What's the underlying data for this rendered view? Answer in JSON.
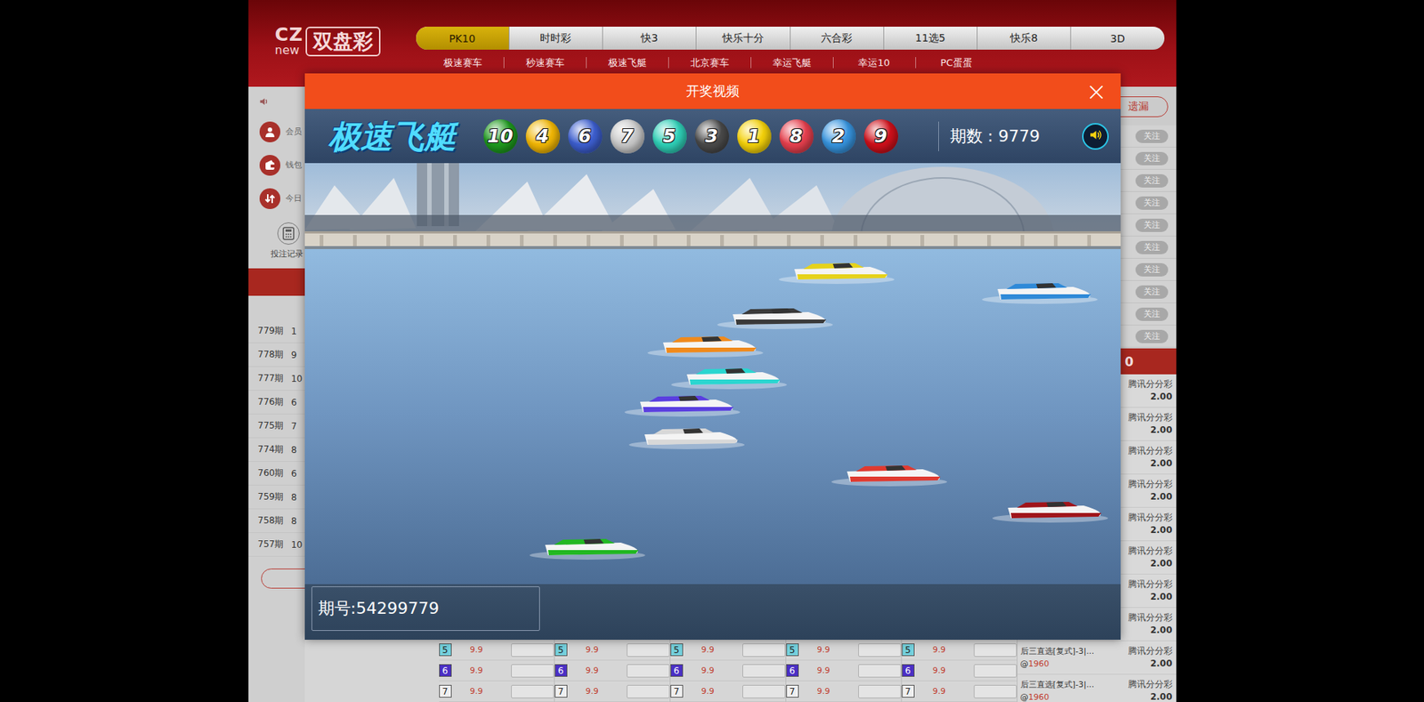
{
  "logo": {
    "cz": "CZ",
    "new": "new",
    "name": "双盘彩"
  },
  "nav": [
    {
      "label": "PK10",
      "selected": true
    },
    {
      "label": "时时彩",
      "selected": false
    },
    {
      "label": "快3",
      "selected": false
    },
    {
      "label": "快乐十分",
      "selected": false
    },
    {
      "label": "六合彩",
      "selected": false
    },
    {
      "label": "11选5",
      "selected": false
    },
    {
      "label": "快乐8",
      "selected": false
    },
    {
      "label": "3D",
      "selected": false
    }
  ],
  "subnav": [
    {
      "label": "极速赛车"
    },
    {
      "label": "秒速赛车"
    },
    {
      "label": "极速飞艇"
    },
    {
      "label": "北京赛车"
    },
    {
      "label": "幸运飞艇"
    },
    {
      "label": "幸运10"
    },
    {
      "label": "PC蛋蛋"
    }
  ],
  "sidebar": {
    "items": [
      {
        "label": "会员"
      },
      {
        "label": "钱包"
      },
      {
        "label": "今日"
      }
    ],
    "record": "投注记录",
    "history": [
      {
        "issue": "779期",
        "num": "1"
      },
      {
        "issue": "778期",
        "num": "9"
      },
      {
        "issue": "777期",
        "num": "10"
      },
      {
        "issue": "776期",
        "num": "6"
      },
      {
        "issue": "775期",
        "num": "7"
      },
      {
        "issue": "774期",
        "num": "8"
      },
      {
        "issue": "760期",
        "num": "6"
      },
      {
        "issue": "759期",
        "num": "8"
      },
      {
        "issue": "758期",
        "num": "8"
      },
      {
        "issue": "757期",
        "num": "10"
      }
    ]
  },
  "right_panel": {
    "button": "遗漏",
    "follow": [
      {
        "label": "关注"
      },
      {
        "label": "关注"
      },
      {
        "label": "关注"
      },
      {
        "label": "关注"
      },
      {
        "label": "关注"
      },
      {
        "label": "关注"
      },
      {
        "label": "关注"
      },
      {
        "label": "关注"
      },
      {
        "label": "关注"
      },
      {
        "label": "关注"
      }
    ],
    "bar": "0",
    "rows": [
      {
        "lottery": "腾讯分分彩",
        "amount": "2.00"
      },
      {
        "lottery": "腾讯分分彩",
        "amount": "2.00"
      },
      {
        "lottery": "腾讯分分彩",
        "amount": "2.00"
      },
      {
        "lottery": "腾讯分分彩",
        "amount": "2.00"
      },
      {
        "lottery": "腾讯分分彩",
        "amount": "2.00"
      },
      {
        "lottery": "腾讯分分彩",
        "amount": "2.00"
      },
      {
        "lottery": "腾讯分分彩",
        "amount": "2.00"
      },
      {
        "lottery": "腾讯分分彩",
        "amount": "2.00"
      },
      {
        "bet": "后三直选[复式]-3|...",
        "at": "@",
        "odds": "1960",
        "lottery": "腾讯分分彩",
        "amount": "2.00"
      },
      {
        "bet": "后三直选[复式]-3|...",
        "at": "@",
        "odds": "1960",
        "lottery": "腾讯分分彩",
        "amount": "2.00"
      }
    ]
  },
  "bet_grid": {
    "columns": [
      {
        "rows": [
          {
            "num": "5",
            "odds": "9.9",
            "color": "#74d0dc"
          },
          {
            "num": "6",
            "odds": "9.9",
            "color": "#4a2fc4"
          },
          {
            "num": "7",
            "odds": "9.9",
            "color": "#efefef"
          }
        ]
      },
      {
        "rows": [
          {
            "num": "5",
            "odds": "9.9",
            "color": "#74d0dc"
          },
          {
            "num": "6",
            "odds": "9.9",
            "color": "#4a2fc4"
          },
          {
            "num": "7",
            "odds": "9.9",
            "color": "#efefef"
          }
        ]
      },
      {
        "rows": [
          {
            "num": "5",
            "odds": "9.9",
            "color": "#74d0dc"
          },
          {
            "num": "6",
            "odds": "9.9",
            "color": "#4a2fc4"
          },
          {
            "num": "7",
            "odds": "9.9",
            "color": "#efefef"
          }
        ]
      },
      {
        "rows": [
          {
            "num": "5",
            "odds": "9.9",
            "color": "#74d0dc"
          },
          {
            "num": "6",
            "odds": "9.9",
            "color": "#4a2fc4"
          },
          {
            "num": "7",
            "odds": "9.9",
            "color": "#efefef"
          }
        ]
      },
      {
        "rows": [
          {
            "num": "5",
            "odds": "9.9",
            "color": "#74d0dc"
          },
          {
            "num": "6",
            "odds": "9.9",
            "color": "#4a2fc4"
          },
          {
            "num": "7",
            "odds": "9.9",
            "color": "#efefef"
          }
        ]
      }
    ]
  },
  "modal": {
    "title": "开奖视频",
    "close": "×",
    "game": "极速飞艇",
    "balls": [
      {
        "num": "10",
        "color": "#1e9a1e"
      },
      {
        "num": "4",
        "color": "#f2b705"
      },
      {
        "num": "6",
        "color": "#3d5fd0"
      },
      {
        "num": "7",
        "color": "#c9c9c9"
      },
      {
        "num": "5",
        "color": "#2fd1b8"
      },
      {
        "num": "3",
        "color": "#4a4a4a"
      },
      {
        "num": "1",
        "color": "#f5d20a"
      },
      {
        "num": "8",
        "color": "#e8404e"
      },
      {
        "num": "2",
        "color": "#3795e0"
      },
      {
        "num": "9",
        "color": "#d0101a"
      }
    ],
    "period": "期数 : 9779",
    "issue": "期号:54299779"
  }
}
